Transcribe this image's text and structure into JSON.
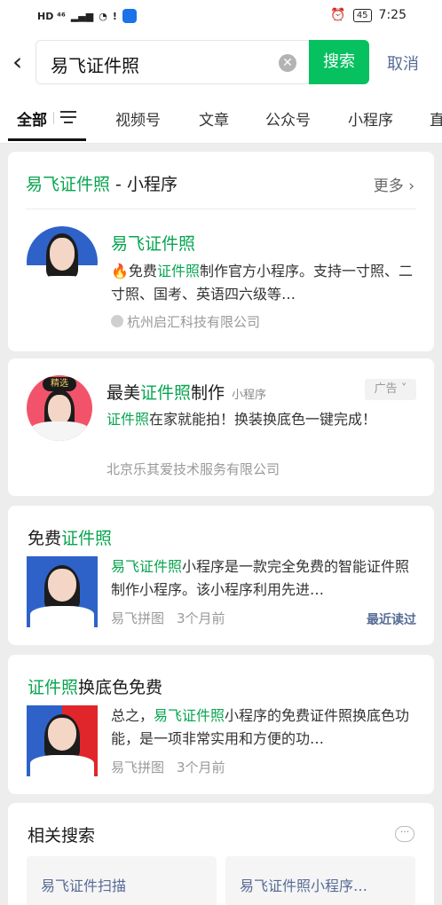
{
  "status_bar": {
    "network": "HD ⁴⁶",
    "battery": "45",
    "time": "7:25"
  },
  "search": {
    "query": "易飞证件照",
    "search_label": "搜索",
    "cancel_label": "取消"
  },
  "tabs": [
    {
      "label": "全部"
    },
    {
      "label": "视频号"
    },
    {
      "label": "文章"
    },
    {
      "label": "公众号"
    },
    {
      "label": "小程序"
    },
    {
      "label": "直"
    }
  ],
  "mini_program_card": {
    "header_name": "易飞证件照",
    "header_suffix": " - 小程序",
    "more_label": "更多",
    "title": "易飞证件照",
    "desc_prefix": "🔥免费",
    "desc_highlight": "证件照",
    "desc_rest": "制作官方小程序。支持一寸照、二寸照、国考、英语四六级等…",
    "company": "杭州启汇科技有限公司"
  },
  "ad_card": {
    "badge": "精选",
    "title_prefix": "最美",
    "title_highlight": "证件照",
    "title_suffix": "制作",
    "type_tag": "小程序",
    "ad_label": "广告",
    "desc_highlight": "证件照",
    "desc_rest": "在家就能拍！换装换底色一键完成！",
    "company": "北京乐其爱技术服务有限公司"
  },
  "articles": [
    {
      "title_prefix": "免费",
      "title_highlight": "证件照",
      "title_suffix": "",
      "desc_prefix": "",
      "desc_highlight": "易飞证件照",
      "desc_rest": "小程序是一款完全免费的智能证件照制作小程序。该小程序利用先进…",
      "source": "易飞拼图",
      "time": "3个月前",
      "recent": "最近读过"
    },
    {
      "title_prefix": "",
      "title_highlight": "证件照",
      "title_suffix": "换底色免费",
      "desc_prefix": "总之，",
      "desc_highlight": "易飞证件照",
      "desc_rest": "小程序的免费证件照换底色功能，是一项非常实用和方便的功…",
      "source": "易飞拼图",
      "time": "3个月前",
      "recent": ""
    }
  ],
  "related": {
    "title": "相关搜索",
    "items": [
      "易飞证件扫描",
      "易飞证件照小程序…"
    ]
  },
  "colors": {
    "accent_green": "#07c160",
    "link_blue": "#576b95",
    "highlight_green": "#07a550"
  }
}
